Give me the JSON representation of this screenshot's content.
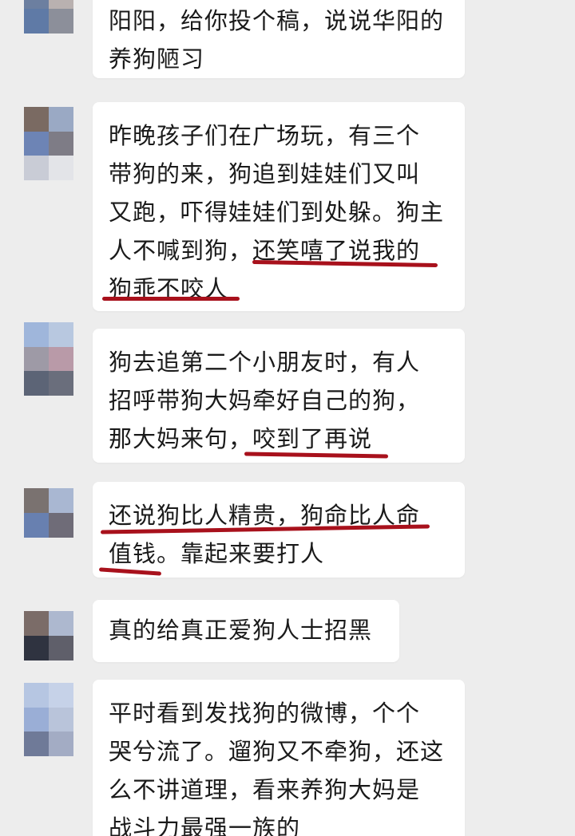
{
  "colors": {
    "background": "#ededed",
    "bubble": "#ffffff",
    "underline": "#a8111c"
  },
  "messages": [
    {
      "lines": [
        "阳阳，给你投个稿，说说华阳的",
        "养狗陋习"
      ]
    },
    {
      "lines": [
        "昨晚孩子们在广场玩，有三个",
        "带狗的来，狗追到娃娃们又叫",
        "又跑，吓得娃娃们到处躲。狗主",
        "人不喊到狗，还笑嘻了说我的",
        "狗乖不咬人"
      ]
    },
    {
      "lines": [
        "狗去追第二个小朋友时，有人",
        "招呼带狗大妈牵好自己的狗，",
        "那大妈来句，咬到了再说"
      ]
    },
    {
      "lines": [
        "还说狗比人精贵，狗命比人命",
        "值钱。靠起来要打人"
      ]
    },
    {
      "lines": [
        "真的给真正爱狗人士招黑"
      ]
    },
    {
      "lines": [
        "平时看到发找狗的微博，个个",
        "哭兮流了。遛狗又不牵狗，还这",
        "么不讲道理，看来养狗大妈是",
        "战斗力最强一族的"
      ]
    }
  ]
}
